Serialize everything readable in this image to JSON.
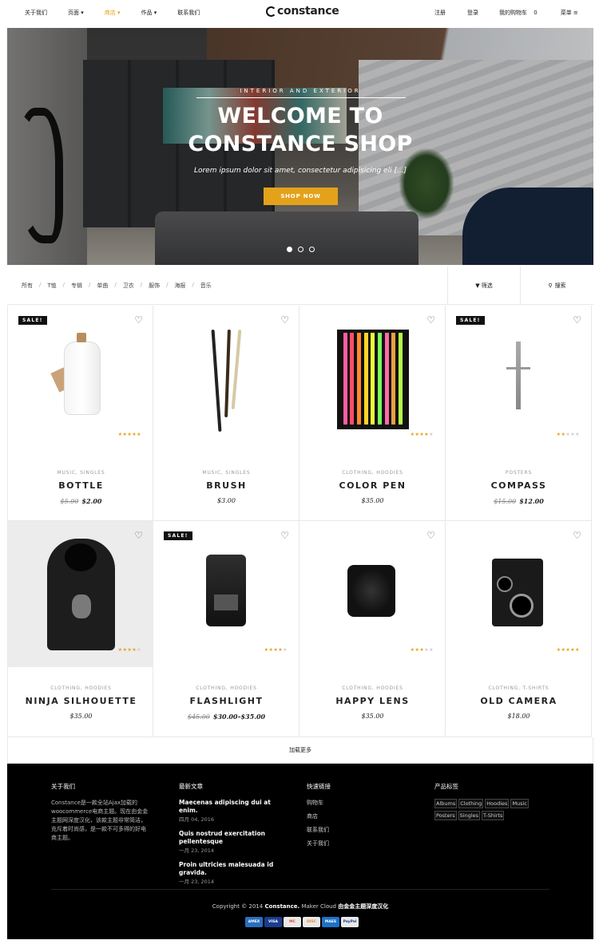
{
  "header": {
    "nav_left": [
      "关于我们",
      "页面 ▾",
      "商店 ▾",
      "作品 ▾",
      "联系我们"
    ],
    "logo": "constance",
    "nav_right": {
      "register": "注册",
      "login": "登录",
      "cart_label": "我的购物车",
      "cart_count": "0",
      "menu": "菜单 ≡"
    }
  },
  "hero": {
    "subtitle": "INTERIOR AND EXTERIOR",
    "title_line1": "WELCOME TO",
    "title_line2": "CONSTANCE SHOP",
    "description": "Lorem ipsum dolor sit amet, consectetur adipisicing eli [...]",
    "button": "SHOP NOW",
    "slides": 3,
    "active_slide": 1
  },
  "filter": {
    "categories": [
      "所有",
      "T恤",
      "专辑",
      "单曲",
      "卫衣",
      "服饰",
      "海报",
      "音乐"
    ],
    "filter_label": "▼ 筛选",
    "search_label": "搜索"
  },
  "products": [
    {
      "name": "BOTTLE",
      "categories": "MUSIC, SINGLES",
      "old_price": "$5.00",
      "price": "$2.00",
      "sale": true,
      "sale_label": "SALE!",
      "rating": 4.5
    },
    {
      "name": "BRUSH",
      "categories": "MUSIC, SINGLES",
      "old_price": "",
      "price": "$3.00",
      "sale": false,
      "sale_label": "",
      "rating": 0
    },
    {
      "name": "COLOR PEN",
      "categories": "CLOTHING, HOODIES",
      "old_price": "",
      "price": "$35.00",
      "sale": false,
      "sale_label": "",
      "rating": 4
    },
    {
      "name": "COMPASS",
      "categories": "POSTERS",
      "old_price": "$15.00",
      "price": "$12.00",
      "sale": true,
      "sale_label": "SALE!",
      "rating": 2
    },
    {
      "name": "NINJA SILHOUETTE",
      "categories": "CLOTHING, HOODIES",
      "old_price": "",
      "price": "$35.00",
      "sale": false,
      "sale_label": "",
      "rating": 4
    },
    {
      "name": "FLASHLIGHT",
      "categories": "CLOTHING, HOODIES",
      "old_price": "$45.00",
      "price": "$30.00–$35.00",
      "sale": true,
      "sale_label": "SALE!",
      "rating": 4
    },
    {
      "name": "HAPPY LENS",
      "categories": "CLOTHING, HOODIES",
      "old_price": "",
      "price": "$35.00",
      "sale": false,
      "sale_label": "",
      "rating": 3
    },
    {
      "name": "OLD CAMERA",
      "categories": "CLOTHING, T-SHIRTS",
      "old_price": "",
      "price": "$18.00",
      "sale": false,
      "sale_label": "",
      "rating": 5
    }
  ],
  "load_more": "加载更多",
  "footer": {
    "about_title": "关于我们",
    "about_text": "Constance是一款全站Ajax加载的woocommerce电商主题。现在由金金主题网深度汉化，该款主题非常简洁，充斥着时尚感，是一款不可多得的好电商主题。",
    "posts_title": "最新文章",
    "posts": [
      {
        "title": "Maecenas adipiscing dui at enim.",
        "date": "四月 04, 2016"
      },
      {
        "title": "Quis nostrud exercitation pellentesque",
        "date": "一月 23, 2014"
      },
      {
        "title": "Proin ultricies malesuada id gravida.",
        "date": "一月 23, 2014"
      }
    ],
    "links_title": "快速链接",
    "links": [
      "购物车",
      "商店",
      "联系我们",
      "关于我们"
    ],
    "tags_title": "产品标签",
    "tags": [
      "Albums",
      "Clothing",
      "Hoodies",
      "Music",
      "Posters",
      "Singles",
      "T-Shirts"
    ],
    "copyright_pre": "Copyright © 2014",
    "copyright_brand": "Constance.",
    "copyright_post": "Maker Cloud",
    "copyright_cn": "由金金主题深度汉化",
    "payments": [
      {
        "name": "AMEX",
        "color": "#2a6fbd"
      },
      {
        "name": "VISA",
        "color": "#1a3d8f"
      },
      {
        "name": "MC",
        "color": "#e9e9e9"
      },
      {
        "name": "DISC",
        "color": "#e9e9e9"
      },
      {
        "name": "MAES",
        "color": "#1a73c9"
      },
      {
        "name": "PayPal",
        "color": "#e9e9e9"
      }
    ]
  },
  "colors": {
    "accent": "#e3a21a",
    "dark": "#000000"
  }
}
